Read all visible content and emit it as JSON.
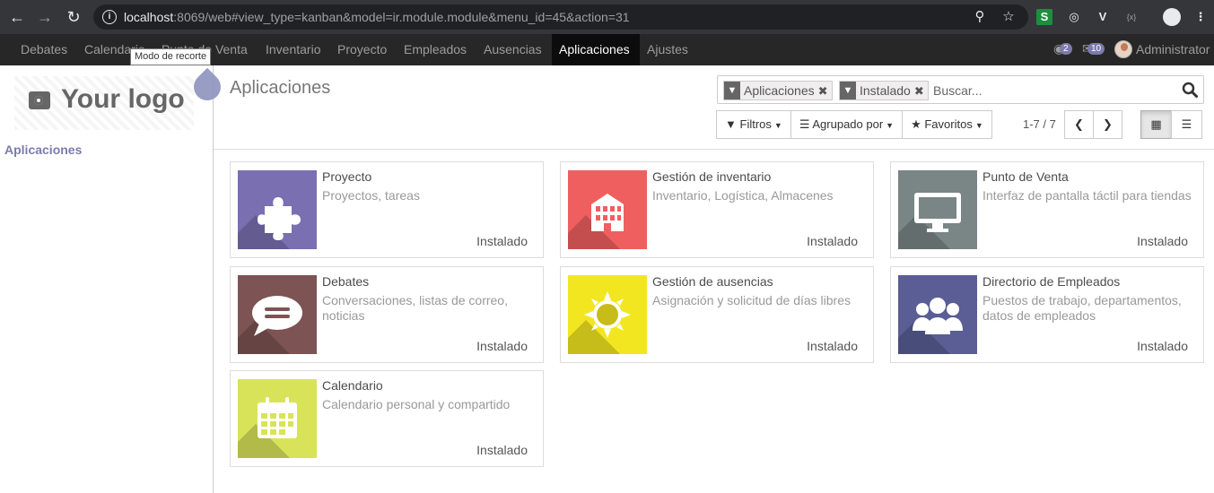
{
  "browser": {
    "url_host": "localhost",
    "url_rest": ":8069/web#view_type=kanban&model=ir.module.module&menu_id=45&action=31"
  },
  "topnav": {
    "items": [
      "Debates",
      "Calendario",
      "Punto de Venta",
      "Inventario",
      "Proyecto",
      "Empleados",
      "Ausencias",
      "Aplicaciones",
      "Ajustes"
    ],
    "active": "Aplicaciones",
    "messages_badge": "2",
    "activities_badge": "10",
    "user": "Administrator"
  },
  "tooltip": "Modo de recorte",
  "sidebar": {
    "logo_text": "Your logo",
    "link": "Aplicaciones"
  },
  "control": {
    "title": "Aplicaciones",
    "facets": [
      "Aplicaciones",
      "Instalado"
    ],
    "search_placeholder": "Buscar...",
    "filters_label": "Filtros",
    "groupby_label": "Agrupado por",
    "favorites_label": "Favoritos",
    "pager": "1-7 / 7"
  },
  "apps": [
    {
      "title": "Proyecto",
      "desc": "Proyectos, tareas",
      "status": "Instalado",
      "color": "#7a6fb0",
      "icon": "puzzle-icon"
    },
    {
      "title": "Gestión de inventario",
      "desc": "Inventario, Logística, Almacenes",
      "status": "Instalado",
      "color": "#f05f5f",
      "icon": "building-icon"
    },
    {
      "title": "Punto de Venta",
      "desc": "Interfaz de pantalla táctil para tiendas",
      "status": "Instalado",
      "color": "#7a8586",
      "icon": "monitor-icon"
    },
    {
      "title": "Debates",
      "desc": "Conversaciones, listas de correo, noticias",
      "status": "Instalado",
      "color": "#7d5453",
      "icon": "chat-bubble-icon"
    },
    {
      "title": "Gestión de ausencias",
      "desc": "Asignación y solicitud de días libres",
      "status": "Instalado",
      "color": "#f2e620",
      "icon": "sun-icon"
    },
    {
      "title": "Directorio de Empleados",
      "desc": "Puestos de trabajo, departamentos, datos de empleados",
      "status": "Instalado",
      "color": "#5a5e94",
      "icon": "users-icon"
    },
    {
      "title": "Calendario",
      "desc": "Calendario personal y compartido",
      "status": "Instalado",
      "color": "#d9e35a",
      "icon": "calendar-icon"
    }
  ]
}
